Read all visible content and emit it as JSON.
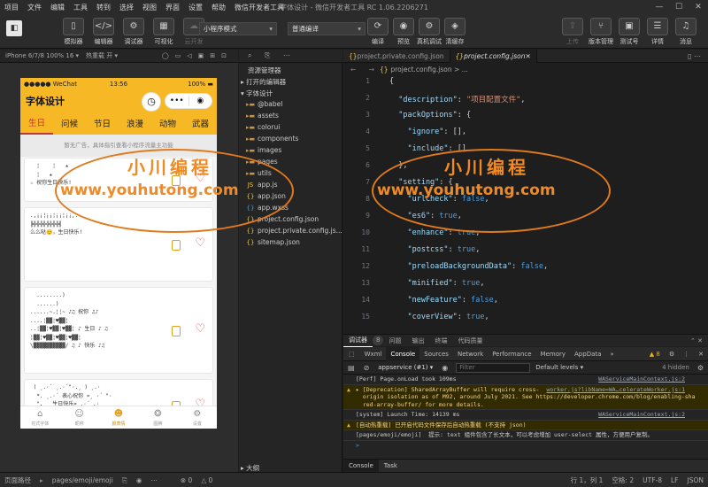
{
  "menu": [
    "项目",
    "文件",
    "编辑",
    "工具",
    "转到",
    "选择",
    "视图",
    "界面",
    "设置",
    "帮助",
    "微信开发者工具"
  ],
  "app_title": "字体设计 - 微信开发者工具 RC 1.06.2206271",
  "toolbar": {
    "left_buttons": [
      {
        "label": "模拟器",
        "icon": "phone-icon"
      },
      {
        "label": "编辑器",
        "icon": "code-icon"
      },
      {
        "label": "调试器",
        "icon": "debug-icon"
      },
      {
        "label": "可视化",
        "icon": "visual-icon"
      },
      {
        "label": "云开发",
        "icon": "cloud-icon"
      }
    ],
    "mode_select": "小程序模式",
    "compile_select": "普通编译",
    "mid_buttons": [
      {
        "label": "编译",
        "icon": "refresh-icon"
      },
      {
        "label": "预览",
        "icon": "eye-icon"
      },
      {
        "label": "真机调试",
        "icon": "device-icon"
      },
      {
        "label": "清缓存",
        "icon": "layers-icon"
      }
    ],
    "right_buttons": [
      {
        "label": "上传",
        "icon": "upload-icon"
      },
      {
        "label": "版本管理",
        "icon": "version-icon"
      },
      {
        "label": "测试号",
        "icon": "test-icon"
      },
      {
        "label": "详情",
        "icon": "details-icon"
      },
      {
        "label": "消息",
        "icon": "bell-icon"
      }
    ]
  },
  "simulator": {
    "device": "iPhone 6/7/8 100% 16 ▾",
    "hot_reload": "热重载 开 ▾",
    "status": {
      "carrier": "●●●●● WeChat",
      "time": "13:56",
      "battery": "100%"
    },
    "title": "字体设计",
    "tabs": [
      "生日",
      "问候",
      "节日",
      "浪漫",
      "动物",
      "武器"
    ],
    "active_tab": 0,
    "ad_text": "暂无广告，具体指引查看小程序流量主功能",
    "cards": [
      {
        "text": "  ¦    ¦   ★\n  ¦   ★\n☆ 祝你生日快乐!"
      },
      {
        "text": ".,¡¡¦¡¡¦¡¡¦¡¡,.\n╠╬╬╬╬╬╬╬╬╣\n么么哒😊，生日快乐!"
      },
      {
        "text": "  ........)\n  ......)\n......~.¦¦~ ♪♫ 祝你 ♫♪\n....¦▓▓¦♥▓▓¦\n..¦▓▓¦♥▓▓¦♥▓▓¦ ♪ 生日 ♪ ♫\n¦▓▓¦♥▓▓¦♥▓▓¦♥▓▓¦\n\\▓▓▓▓▓▓▓▓▓▓/ ♫ ♪ 快乐 ♪♫"
      },
      {
        "text": " ( ¸.·´ ¸.·´\"·.¸ ) ¸.·\n  *. ¸.·´ 表心祝你 ¤¸ ·´ \"·\n  \". ¸ 生日快乐¤¸.·´ .·\n (¸.·´ (¸.·´ \"·.¸) ¸.·´"
      }
    ],
    "bottom_nav": [
      {
        "label": "花式字体",
        "icon": "home-icon"
      },
      {
        "label": "昵称",
        "icon": "smile-icon"
      },
      {
        "label": "颜表情",
        "icon": "emoji-icon"
      },
      {
        "label": "图腾",
        "icon": "totem-icon"
      },
      {
        "label": "设置",
        "icon": "gear-icon"
      }
    ],
    "active_nav": 2
  },
  "explorer": {
    "title": "资源管理器",
    "sections": [
      {
        "label": "打开的编辑器"
      },
      {
        "label": "字体设计"
      }
    ],
    "items": [
      {
        "name": "@babel",
        "kind": "folder"
      },
      {
        "name": "assets",
        "kind": "folder"
      },
      {
        "name": "colorui",
        "kind": "folder"
      },
      {
        "name": "components",
        "kind": "folder"
      },
      {
        "name": "images",
        "kind": "folder"
      },
      {
        "name": "pages",
        "kind": "folder"
      },
      {
        "name": "utils",
        "kind": "folder"
      },
      {
        "name": "app.js",
        "kind": "js"
      },
      {
        "name": "app.json",
        "kind": "json"
      },
      {
        "name": "app.wxss",
        "kind": "wxss"
      },
      {
        "name": "project.config.json",
        "kind": "json"
      },
      {
        "name": "project.private.config.js...",
        "kind": "json"
      },
      {
        "name": "sitemap.json",
        "kind": "json"
      }
    ],
    "outline": "大纲"
  },
  "editor": {
    "tabs": [
      {
        "label": "project.private.config.json",
        "active": false
      },
      {
        "label": "project.config.json",
        "active": true
      }
    ],
    "breadcrumb": "project.config.json > ...",
    "lines": [
      [
        {
          "c": "p",
          "t": "{"
        }
      ],
      [
        {
          "c": "k",
          "t": "  \"description\""
        },
        {
          "c": "p",
          "t": ": "
        },
        {
          "c": "s",
          "t": "\"项目配置文件\""
        },
        {
          "c": "p",
          "t": ","
        }
      ],
      [
        {
          "c": "k",
          "t": "  \"packOptions\""
        },
        {
          "c": "p",
          "t": ": {"
        }
      ],
      [
        {
          "c": "k",
          "t": "    \"ignore\""
        },
        {
          "c": "p",
          "t": ": [],"
        }
      ],
      [
        {
          "c": "k",
          "t": "    \"include\""
        },
        {
          "c": "p",
          "t": ": []"
        }
      ],
      [
        {
          "c": "p",
          "t": "  },"
        }
      ],
      [
        {
          "c": "k",
          "t": "  \"setting\""
        },
        {
          "c": "p",
          "t": ": {"
        }
      ],
      [
        {
          "c": "k",
          "t": "    \"urlCheck\""
        },
        {
          "c": "p",
          "t": ": "
        },
        {
          "c": "b",
          "t": "false"
        },
        {
          "c": "p",
          "t": ","
        }
      ],
      [
        {
          "c": "k",
          "t": "    \"es6\""
        },
        {
          "c": "p",
          "t": ": "
        },
        {
          "c": "b",
          "t": "true"
        },
        {
          "c": "p",
          "t": ","
        }
      ],
      [
        {
          "c": "k",
          "t": "    \"enhance\""
        },
        {
          "c": "p",
          "t": ": "
        },
        {
          "c": "b",
          "t": "true"
        },
        {
          "c": "p",
          "t": ","
        }
      ],
      [
        {
          "c": "k",
          "t": "    \"postcss\""
        },
        {
          "c": "p",
          "t": ": "
        },
        {
          "c": "b",
          "t": "true"
        },
        {
          "c": "p",
          "t": ","
        }
      ],
      [
        {
          "c": "k",
          "t": "    \"preloadBackgroundData\""
        },
        {
          "c": "p",
          "t": ": "
        },
        {
          "c": "b",
          "t": "false"
        },
        {
          "c": "p",
          "t": ","
        }
      ],
      [
        {
          "c": "k",
          "t": "    \"minified\""
        },
        {
          "c": "p",
          "t": ": "
        },
        {
          "c": "b",
          "t": "true"
        },
        {
          "c": "p",
          "t": ","
        }
      ],
      [
        {
          "c": "k",
          "t": "    \"newFeature\""
        },
        {
          "c": "p",
          "t": ": "
        },
        {
          "c": "b",
          "t": "false"
        },
        {
          "c": "p",
          "t": ","
        }
      ],
      [
        {
          "c": "k",
          "t": "    \"coverView\""
        },
        {
          "c": "p",
          "t": ": "
        },
        {
          "c": "b",
          "t": "true"
        },
        {
          "c": "p",
          "t": ","
        }
      ]
    ]
  },
  "devtools": {
    "tabs": [
      "调试器",
      "8",
      "问题",
      "输出",
      "终端",
      "代码质量"
    ],
    "panel_tabs": [
      "Wxml",
      "Console",
      "Sources",
      "Network",
      "Performance",
      "Memory",
      "AppData"
    ],
    "active_panel": 1,
    "more": "»",
    "warn_count": "▲ 8",
    "context": "appservice (#1)",
    "filter_placeholder": "Filter",
    "levels": "Default levels ▾",
    "hidden": "4 hidden",
    "messages": [
      {
        "level": "info",
        "text": "[Perf] Page.onLoad took 109ms",
        "src": "WAServiceMainContext.js:2"
      },
      {
        "level": "warn",
        "text": "▸ [Deprecation] SharedArrayBuffer will require cross-\n  origin isolation as of M92, around July 2021. See https://developer.chrome.com/blog/enabling-sha\n  red-array-buffer/ for more details.",
        "src": "worker.js?libName=WA…celerateWorker.js:1"
      },
      {
        "level": "info",
        "text": "[system] Launch Time: 14139 ms",
        "src": "WAServiceMainContext.js:2"
      },
      {
        "level": "warn",
        "text": "[自动热重载] 已开启代码文件保存后自动热重载 (不支持 json)",
        "src": ""
      },
      {
        "level": "info",
        "text": "[pages/emoji/emoji]  提示: text 组件包含了长文本，可以考虑增加 user-select 属性，方便用户复制。",
        "src": ""
      }
    ],
    "prompt": ">",
    "bottom_tabs": [
      "Console",
      "Task"
    ]
  },
  "statusline": {
    "page_path_label": "页面路径",
    "page_path": "pages/emoji/emoji",
    "errors": "⊗ 0",
    "warnings": "△ 0",
    "position": "行 1，列 1",
    "spaces": "空格: 2",
    "encoding": "UTF-8",
    "eol": "LF",
    "lang": "JSON"
  },
  "watermark": {
    "title": "小川编程",
    "url": "www.youhutong.com"
  }
}
